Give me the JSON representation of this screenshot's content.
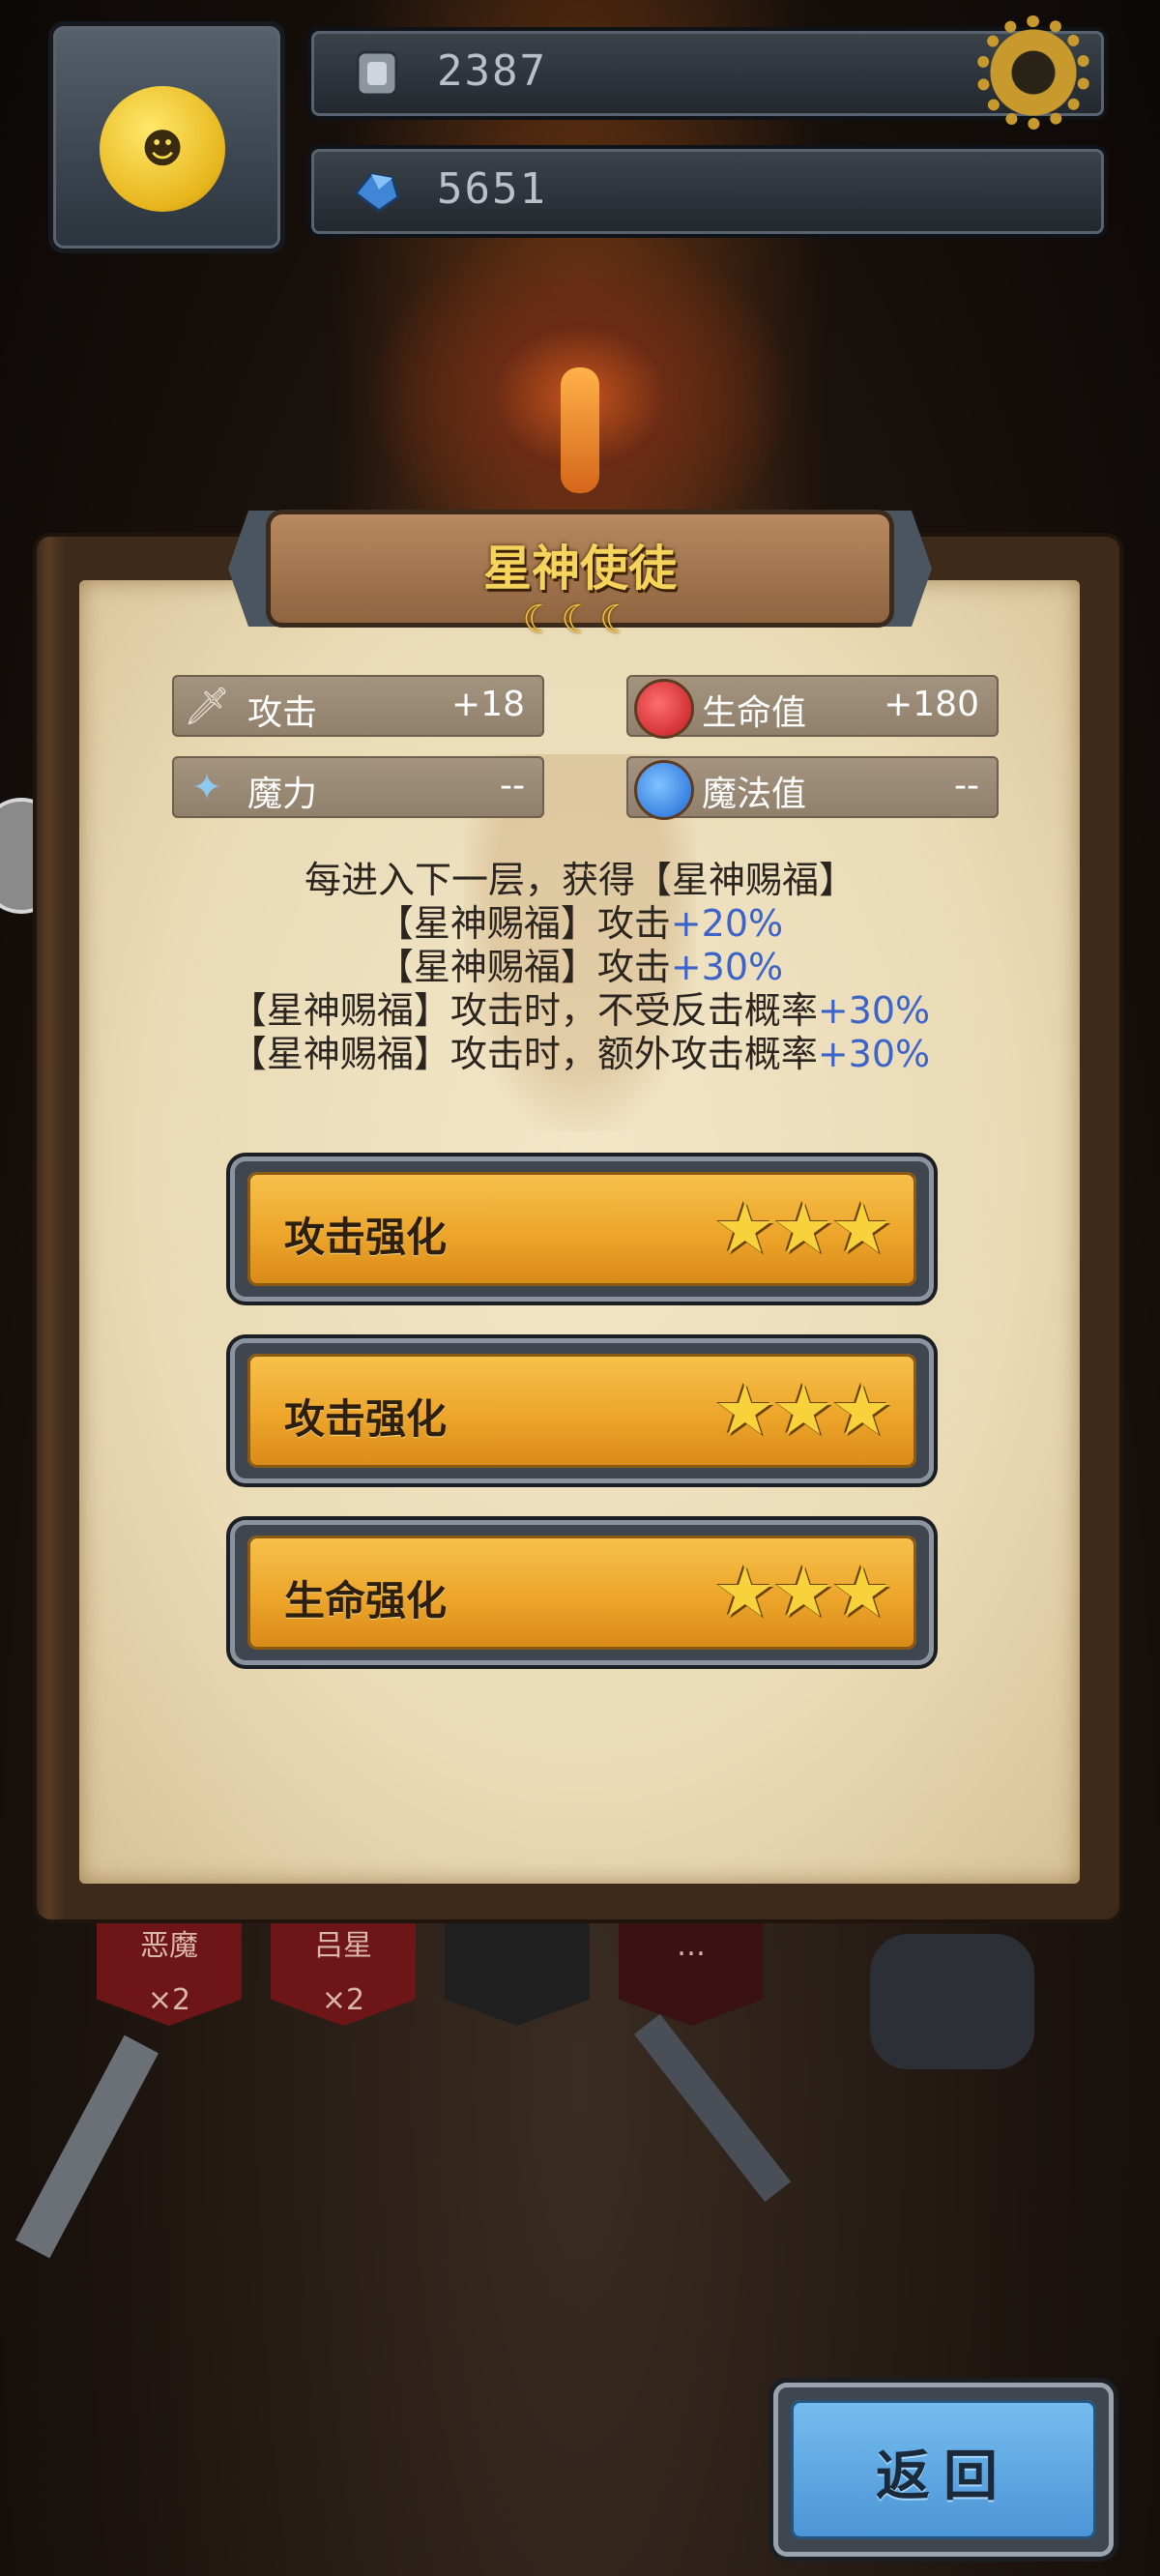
{
  "top_bar": {
    "gold_value": "2387",
    "gem_value": "5651",
    "icons": {
      "gold": "gold-coin-icon",
      "gem": "blue-gem-icon",
      "settings": "gear-icon"
    }
  },
  "panel": {
    "title": "星神使徒",
    "moons": "☾☾☾",
    "stats": [
      {
        "icon": "sword-icon",
        "name": "攻击",
        "value": "+18"
      },
      {
        "icon": "red-potion-icon",
        "name": "生命值",
        "value": "+180"
      },
      {
        "icon": "wand-icon",
        "name": "魔力",
        "value": "--"
      },
      {
        "icon": "blue-potion-icon",
        "name": "魔法值",
        "value": "--"
      }
    ],
    "description": [
      {
        "text": "每进入下一层，获得【星神赐福】",
        "highlight": ""
      },
      {
        "text": "【星神赐福】攻击",
        "highlight": "+20%"
      },
      {
        "text": "【星神赐福】攻击",
        "highlight": "+30%"
      },
      {
        "text": "【星神赐福】攻击时，不受反击概率",
        "highlight": "+30%"
      },
      {
        "text": "【星神赐福】攻击时，额外攻击概率",
        "highlight": "+30%"
      }
    ],
    "upgrades": [
      {
        "label": "攻击强化",
        "stars": 3
      },
      {
        "label": "攻击强化",
        "stars": 3
      },
      {
        "label": "生命强化",
        "stars": 3
      }
    ]
  },
  "background_banners": [
    {
      "line1": "恶魔",
      "line2": "×2"
    },
    {
      "line1": "吕星",
      "line2": "×2"
    },
    {
      "line1": "",
      "line2": ""
    },
    {
      "line1": "…",
      "line2": ""
    }
  ],
  "back_button": {
    "label": "返回"
  },
  "colors": {
    "accent_gold": "#f6d35a",
    "highlight_blue": "#3b63c9",
    "button_orange": "#eda52a",
    "button_blue": "#4b94d6"
  }
}
